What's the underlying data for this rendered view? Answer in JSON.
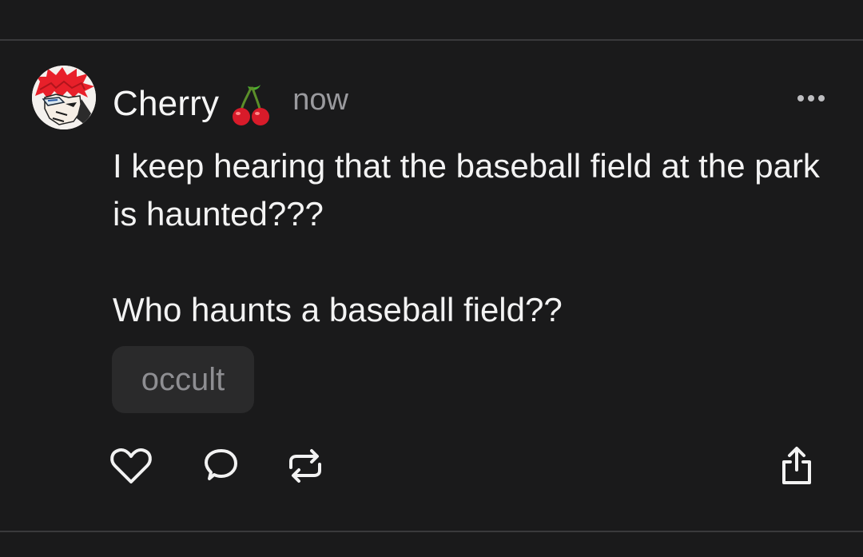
{
  "post": {
    "username": "Cherry",
    "username_emoji": "cherry-emoji",
    "timestamp": "now",
    "body": [
      "I keep hearing that the baseball field at the park is haunted???",
      "Who haunts a baseball field??"
    ],
    "tag": "occult"
  },
  "icons": {
    "more": "more-options-icon",
    "like": "heart-icon",
    "comment": "comment-bubble-icon",
    "reblog": "reblog-icon",
    "share": "share-icon"
  },
  "colors": {
    "background": "#1a1a1b",
    "divider": "#3a3a3c",
    "text": "#f3f3f3",
    "muted": "#9a9a9e",
    "tag_bg": "#2a2a2b",
    "avatar_hair": "#e8202a"
  }
}
